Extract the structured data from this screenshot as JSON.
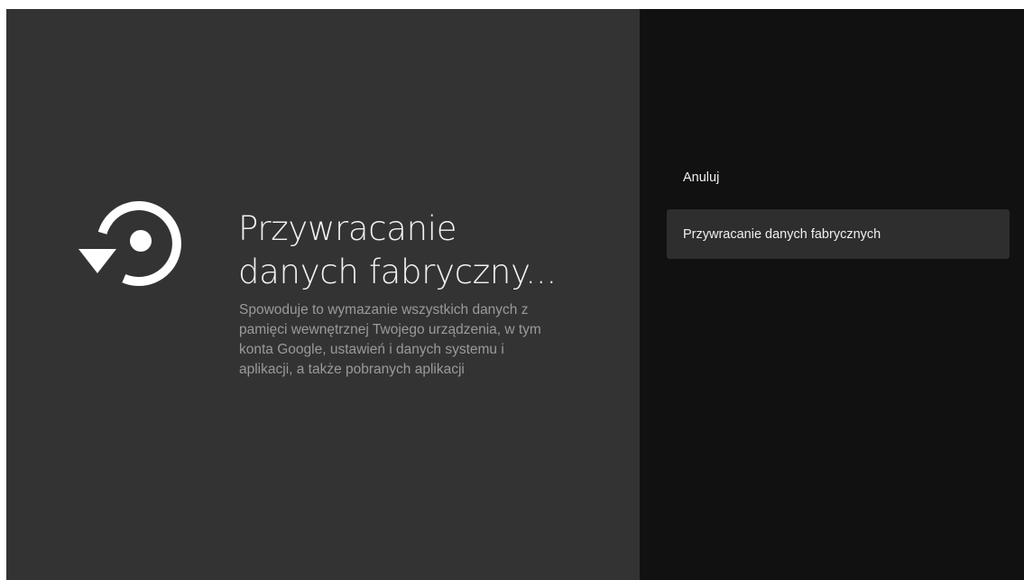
{
  "guidance": {
    "icon": "restore-icon",
    "title_line1": "Przywracanie",
    "title_line2": "danych fabryczny...",
    "description": "Spowoduje to wymazanie wszystkich danych z pamięci wewnętrznej Twojego urządzenia, w tym konta Google, ustawień i danych systemu i aplikacji, a także pobranych aplikacji"
  },
  "actions": [
    {
      "label": "Anuluj",
      "selected": false
    },
    {
      "label": "Przywracanie danych fabrycznych",
      "selected": true
    }
  ],
  "colors": {
    "left_background": "#333333",
    "right_background": "#111111",
    "selected_item_background": "#2e2e2e",
    "title_text": "#f2f2f2",
    "description_text": "#9a9a9a"
  }
}
